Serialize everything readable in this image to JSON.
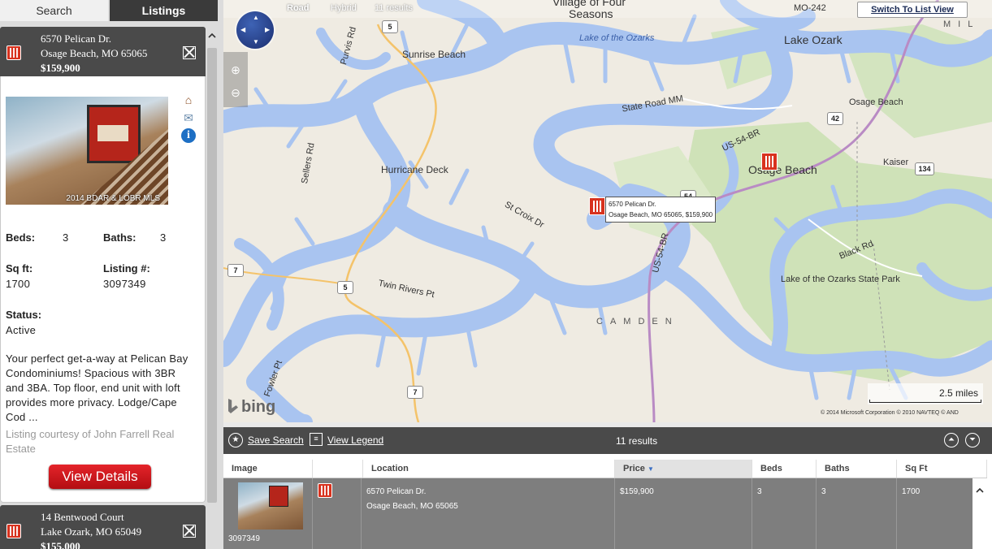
{
  "tabs": {
    "search": "Search",
    "listings": "Listings"
  },
  "listing1": {
    "address1": "6570 Pelican Dr.",
    "address2": "Osage Beach, MO 65065",
    "price": "$159,900",
    "photo_caption": "2014 BDAR & LOBR MLS",
    "beds_label": "Beds:",
    "beds": "3",
    "baths_label": "Baths:",
    "baths": "3",
    "sqft_label": "Sq ft:",
    "sqft": "1700",
    "listing_label": "Listing #:",
    "listing_no": "3097349",
    "status_label": "Status:",
    "status": "Active",
    "description": "Your perfect get-a-way at Pelican Bay Condominiums! Spacious with 3BR and 3BA. Top floor, end unit with loft provides more privacy. Lodge/Cape Cod ...",
    "courtesy": "Listing courtesy of John Farrell Real Estate",
    "view_details": "View Details"
  },
  "listing2": {
    "address1": "14 Bentwood Court",
    "address2": "Lake Ozark, MO 65049",
    "price": "$155,000"
  },
  "map": {
    "road": "Road",
    "hybrid": "Hybrid",
    "results": "11 results",
    "switch": "Switch To List View",
    "scale": "2.5 miles",
    "copyright": "© 2014 Microsoft Corporation    © 2010 NAVTEQ    © AND",
    "brand": "bing",
    "tooltip_line1": "6570 Pelican Dr.",
    "tooltip_line2": "Osage Beach, MO 65065, $159,900",
    "labels": {
      "village": "Village of Four",
      "seasons": "Seasons",
      "lake_of_ozarks": "Lake of the Ozarks",
      "lake_ozark": "Lake Ozark",
      "sunrise_beach": "Sunrise Beach",
      "purvis_rd": "Purvis Rd",
      "state_road_mm": "State Road MM",
      "osage_beach_n": "Osage Beach",
      "kaiser": "Kaiser",
      "sellers_rd": "Sellers Rd",
      "hurricane_deck": "Hurricane Deck",
      "st_croix_dr": "St Croix Dr",
      "osage_beach": "Osage Beach",
      "us54br_a": "US-54-BR",
      "us54br_b": "US-54-BR",
      "black_rd": "Black Rd",
      "state_park": "Lake of the Ozarks State Park",
      "twin_rivers": "Twin Rivers Pt",
      "camden": "CAMDEN",
      "fowler": "Fowler Pt",
      "mil": "MIL",
      "mo": "MO-242"
    },
    "shields": {
      "s5a": "5",
      "s5b": "5",
      "s7a": "7",
      "s7b": "7",
      "s42": "42",
      "s134": "134",
      "s54": "54"
    }
  },
  "results_bar": {
    "save_search": "Save Search",
    "view_legend": "View Legend",
    "count": "11 results"
  },
  "table": {
    "headers": [
      "Image",
      "",
      "Location",
      "Price",
      "Beds",
      "Baths",
      "Sq Ft"
    ],
    "row": {
      "listing_no": "3097349",
      "address1": "6570 Pelican Dr.",
      "address2": "Osage Beach, MO  65065",
      "price": "$159,900",
      "beds": "3",
      "baths": "3",
      "sqft": "1700"
    }
  },
  "colors": {
    "accent": "#d8321e",
    "panel_dark": "#4a4a4a",
    "water": "#a9c4f0"
  }
}
